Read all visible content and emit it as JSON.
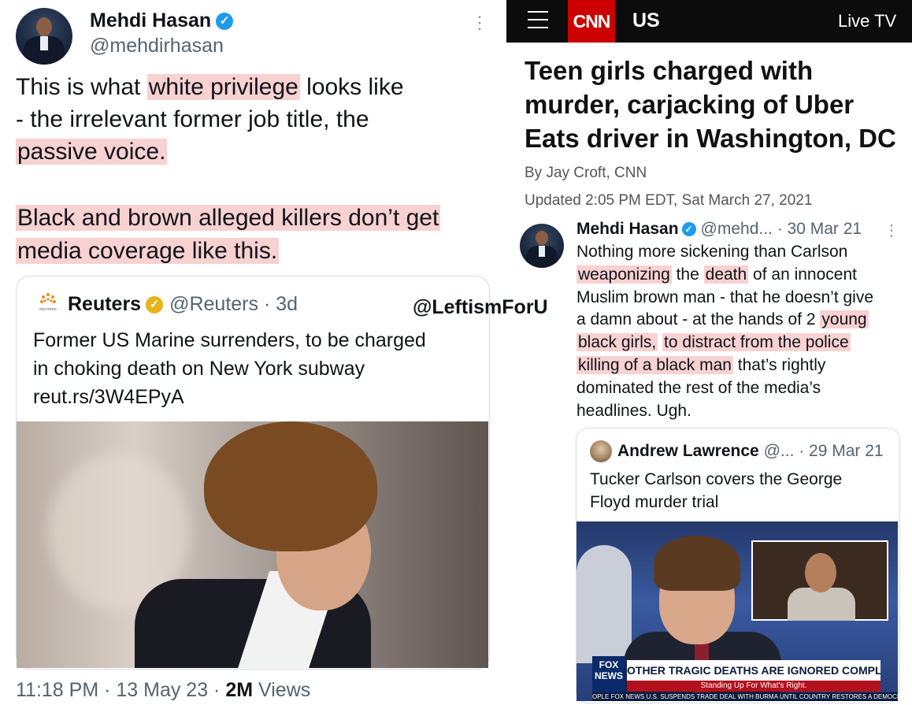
{
  "left_tweet": {
    "author_name": "Mehdi Hasan",
    "author_handle": "@mehdirhasan",
    "verified_glyph": "✓",
    "more_glyph": "⋮",
    "line1_pre": "This is what ",
    "line1_hl": "white privilege",
    "line1_post": " looks like",
    "line2": "- the irrelevant former job title, the",
    "line3_hl": "passive voice.",
    "line4_hl": "Black and brown alleged killers don’t get",
    "line5_hl": "media coverage like this.",
    "quote": {
      "author_name": "Reuters",
      "author_handle": "@Reuters · 3d",
      "logo_text": "REUTERS",
      "text_line1": "Former US Marine surrenders, to be charged",
      "text_line2": "in choking death on New York subway",
      "text_line3": "reut.rs/3W4EPyA"
    },
    "time": "11:18 PM · 13 May 23 · ",
    "views_count": "2M",
    "views_label": " Views"
  },
  "watermark": "@LeftismForU",
  "cnn": {
    "logo": "CNN",
    "section": "US",
    "live_tv": "Live TV",
    "headline_line1": "Teen girls charged with",
    "headline_line2": "murder, carjacking of Uber",
    "headline_line3": "Eats driver in Washington, DC",
    "byline": "By Jay Croft, CNN",
    "updated": "Updated 2:05 PM EDT, Sat March 27, 2021"
  },
  "right_tweet": {
    "author_name": "Mehdi Hasan",
    "author_handle": "@mehd... · 30 Mar 21",
    "more_glyph": "⋮",
    "t1": "Nothing more sickening than Carlson",
    "hl1": "weaponizing",
    "t2": " the ",
    "hl2": "death",
    "t3": " of an innocent",
    "t4": "Muslim brown man - that he doesn’t give",
    "t5": "a damn about - at the hands of 2 ",
    "hl3": "young",
    "hl4": "black girls,",
    "t6": " ",
    "hl5": "to distract from the police",
    "hl6": "killing of a black man",
    "t7": " that’s rightly",
    "t8": "dominated the rest of the media’s",
    "t9": "headlines. Ugh.",
    "quote": {
      "author_name": "Andrew Lawrence",
      "author_handle": "@... · 29 Mar 21",
      "text_line1": "Tucker Carlson covers the George",
      "text_line2": "Floyd murder trial",
      "fox_logo": "FOX NEWS",
      "banner": "OTHER TRAGIC DEATHS ARE IGNORED COMPLETELY",
      "banner_sub": "Standing Up For What's Right.",
      "ticker": "OPLE  FOX NEWS   U.S. SUSPENDS TRADE DEAL WITH BURMA UNTIL COUNTRY RESTORES A DEMOCRATIC"
    }
  }
}
